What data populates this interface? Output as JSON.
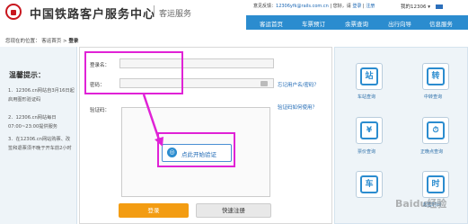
{
  "header": {
    "logo_text": "中国铁路客户服务中心",
    "subtitle": "客运服务",
    "feedback_prefix": "意见反馈：",
    "feedback_email": "12306yfk@rails.com.cn",
    "greeting": "您好，请",
    "login_link": "登录",
    "register_link": "注册",
    "lang_label": "我的12306",
    "lang_arrow": "▾"
  },
  "nav": {
    "items": [
      "客运首页",
      "车票预订",
      "余票查询",
      "出行向导",
      "信息服务"
    ]
  },
  "breadcrumb": {
    "prefix": "您现在的位置：",
    "home": "客运首页",
    "separator": ">",
    "current": "登录"
  },
  "tips": {
    "title": "温馨提示：",
    "items": [
      "1．12306.cn网站自3月16日起启用图形验证码",
      "2．12306.cn网站每日07:00~23:00提供服务",
      "3．在12306.cn网站购票、改签和退票须不晚于开车前2小时"
    ]
  },
  "login_form": {
    "username_label": "登录名：",
    "password_label": "密码：",
    "forgot_link": "忘记用户名/密码？",
    "captcha_label": "验证码：",
    "captcha_help_link": "验证码如何使用？",
    "captcha_button": "点此开始验证",
    "login_button": "登录",
    "register_button": "快速注册"
  },
  "services": [
    {
      "label": "车站查询",
      "icon": "station-icon",
      "glyph": "站"
    },
    {
      "label": "中转查询",
      "icon": "transfer-icon",
      "glyph": "转"
    },
    {
      "label": "票价查询",
      "icon": "fare-icon",
      "glyph": "¥"
    },
    {
      "label": "正晚点查询",
      "icon": "delay-clock-icon",
      "glyph": "⏱"
    },
    {
      "label": "",
      "icon": "train-icon",
      "glyph": "车"
    },
    {
      "label": "起售时间",
      "icon": "sale-time-icon",
      "glyph": "时"
    }
  ],
  "watermark": "Baidu经验",
  "colors": {
    "nav_blue": "#2b8ccf",
    "login_orange": "#f39c12",
    "highlight_magenta": "#e022d6",
    "brand_red": "#c8161e"
  }
}
